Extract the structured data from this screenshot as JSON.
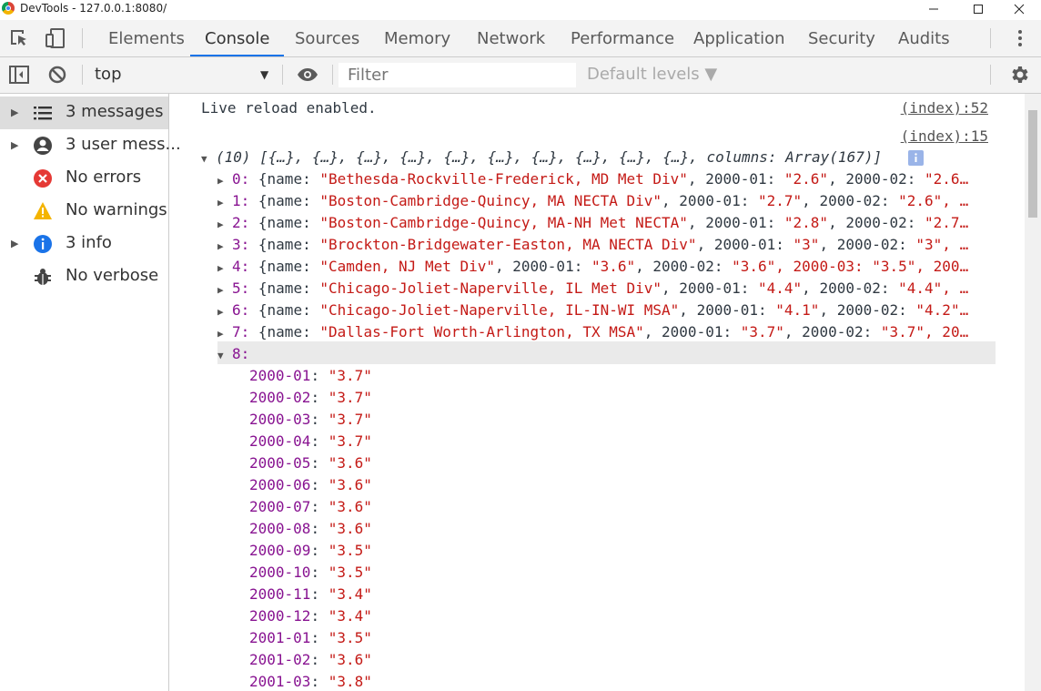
{
  "window": {
    "title": "DevTools - 127.0.0.1:8080/"
  },
  "tabs": [
    "Elements",
    "Console",
    "Sources",
    "Memory",
    "Network",
    "Performance",
    "Application",
    "Security",
    "Audits"
  ],
  "console_toolbar": {
    "context": "top",
    "filter_placeholder": "Filter",
    "levels": "Default levels ▼"
  },
  "sidebar": [
    {
      "label": "3 messages",
      "icon": "list-icon",
      "expandable": true
    },
    {
      "label": "3 user mess...",
      "icon": "user-icon",
      "expandable": true
    },
    {
      "label": "No errors",
      "icon": "error-icon",
      "expandable": false
    },
    {
      "label": "No warnings",
      "icon": "warning-icon",
      "expandable": false
    },
    {
      "label": "3 info",
      "icon": "info-icon",
      "expandable": true
    },
    {
      "label": "No verbose",
      "icon": "bug-icon",
      "expandable": false
    }
  ],
  "messages": {
    "live_reload": {
      "text": "Live reload enabled.",
      "source": "(index):52"
    },
    "array_log": {
      "source": "(index):15",
      "summary": "(10) [{…}, {…}, {…}, {…}, {…}, {…}, {…}, {…}, {…}, {…}, columns: Array(167)]",
      "rows": [
        {
          "index": "0:",
          "open": "{name: ",
          "name": "\"Bethesda-Rockville-Frederick, MD Met Div\"",
          "k1": ", 2000-01: ",
          "v1": "\"2.6\"",
          "k2": ", 2000-02: ",
          "v2": "\"2.6…"
        },
        {
          "index": "1:",
          "open": "{name: ",
          "name": "\"Boston-Cambridge-Quincy, MA NECTA Div\"",
          "k1": ", 2000-01: ",
          "v1": "\"2.7\"",
          "k2": ", 2000-02: ",
          "v2": "\"2.6\", …"
        },
        {
          "index": "2:",
          "open": "{name: ",
          "name": "\"Boston-Cambridge-Quincy, MA-NH Met NECTA\"",
          "k1": ", 2000-01: ",
          "v1": "\"2.8\"",
          "k2": ", 2000-02: ",
          "v2": "\"2.7…"
        },
        {
          "index": "3:",
          "open": "{name: ",
          "name": "\"Brockton-Bridgewater-Easton, MA NECTA Div\"",
          "k1": ", 2000-01: ",
          "v1": "\"3\"",
          "k2": ", 2000-02: ",
          "v2": "\"3\", …"
        },
        {
          "index": "4:",
          "open": "{name: ",
          "name": "\"Camden, NJ Met Div\"",
          "k1": ", 2000-01: ",
          "v1": "\"3.6\"",
          "k2": ", 2000-02: ",
          "v2": "\"3.6\", 2000-03: \"3.5\", 200…"
        },
        {
          "index": "5:",
          "open": "{name: ",
          "name": "\"Chicago-Joliet-Naperville, IL Met Div\"",
          "k1": ", 2000-01: ",
          "v1": "\"4.4\"",
          "k2": ", 2000-02: ",
          "v2": "\"4.4\", …"
        },
        {
          "index": "6:",
          "open": "{name: ",
          "name": "\"Chicago-Joliet-Naperville, IL-IN-WI MSA\"",
          "k1": ", 2000-01: ",
          "v1": "\"4.1\"",
          "k2": ", 2000-02: ",
          "v2": "\"4.2\"…"
        },
        {
          "index": "7:",
          "open": "{name: ",
          "name": "\"Dallas-Fort Worth-Arlington, TX MSA\"",
          "k1": ", 2000-01: ",
          "v1": "\"3.7\"",
          "k2": ", 2000-02: ",
          "v2": "\"3.7\", 20…"
        }
      ],
      "expanded_index": "8:",
      "expanded_entries": [
        {
          "k": "2000-01",
          "v": "\"3.7\""
        },
        {
          "k": "2000-02",
          "v": "\"3.7\""
        },
        {
          "k": "2000-03",
          "v": "\"3.7\""
        },
        {
          "k": "2000-04",
          "v": "\"3.7\""
        },
        {
          "k": "2000-05",
          "v": "\"3.6\""
        },
        {
          "k": "2000-06",
          "v": "\"3.6\""
        },
        {
          "k": "2000-07",
          "v": "\"3.6\""
        },
        {
          "k": "2000-08",
          "v": "\"3.6\""
        },
        {
          "k": "2000-09",
          "v": "\"3.5\""
        },
        {
          "k": "2000-10",
          "v": "\"3.5\""
        },
        {
          "k": "2000-11",
          "v": "\"3.4\""
        },
        {
          "k": "2000-12",
          "v": "\"3.4\""
        },
        {
          "k": "2001-01",
          "v": "\"3.5\""
        },
        {
          "k": "2001-02",
          "v": "\"3.6\""
        },
        {
          "k": "2001-03",
          "v": "\"3.8\""
        }
      ]
    }
  },
  "colors": {
    "key": "#881391",
    "string": "#c41a16",
    "accent": "#1a73e8"
  }
}
